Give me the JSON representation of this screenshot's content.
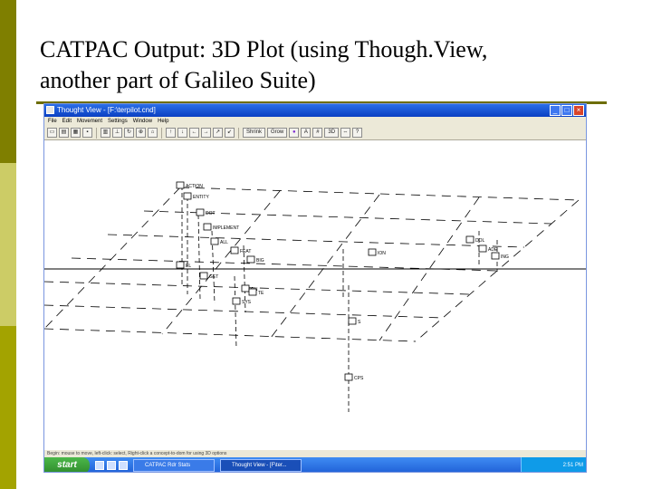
{
  "slide": {
    "title_line1": "CATPAC Output:  3D Plot (using Though.View,",
    "title_line2": "another part of Galileo Suite)"
  },
  "window": {
    "title": "Thought View - [F:\\terpilot.cnd]",
    "controls": [
      "_",
      "□",
      "×"
    ],
    "menu": [
      "File",
      "Edit",
      "Movement",
      "Settings",
      "Window",
      "Help"
    ],
    "toolbar_text_buttons": [
      "Shrink",
      "Grow",
      "3D"
    ],
    "status_text": "Begin: mouse to move, left-click: select, Right-click a concept-to-dom for using 3D options"
  },
  "plot": {
    "labels": [
      "ACTION",
      "ENTITY",
      "DOT",
      "IMPLEMENT",
      "ALL",
      "FEAT",
      "BIG",
      "EL",
      "GET",
      "ION",
      "DOL",
      "ADE",
      "ING",
      "ON",
      "SYS",
      "TE",
      "S",
      "CPS"
    ]
  },
  "taskbar": {
    "start": "start",
    "tasks": [
      "CATPAC Rdr Stats",
      "Thought View - [F\\ter..."
    ],
    "clock": "2:51 PM"
  },
  "colors": {
    "slide_bar_dark": "#7f7f00",
    "slide_bar_light": "#cccc66",
    "xp_blue": "#0a3fc2",
    "start_green": "#2f8b2c"
  }
}
